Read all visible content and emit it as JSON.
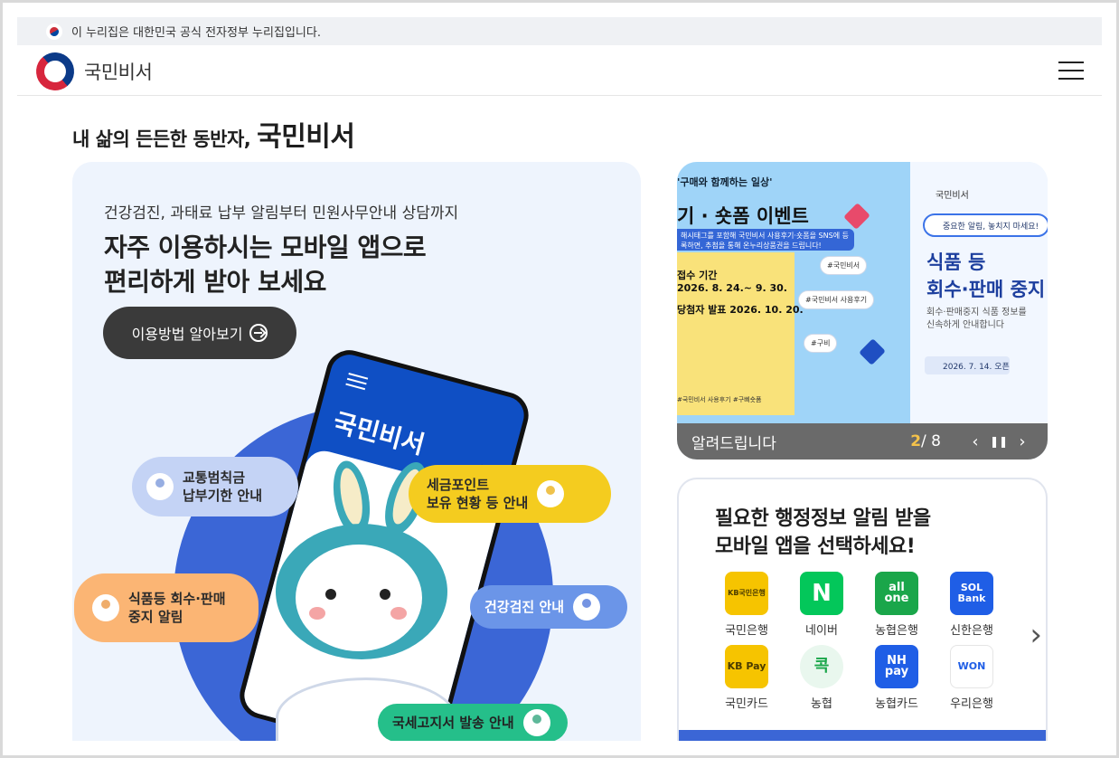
{
  "gov_bar": {
    "text": "이 누리집은 대한민국 공식 전자정부 누리집입니다."
  },
  "header": {
    "logo_text": "국민비서"
  },
  "tagline": {
    "prefix": "내 삶의 든든한 동반자,",
    "brand": "국민비서"
  },
  "hero": {
    "subtitle": "건강검진, 과태료 납부 알림부터 민원사무안내 상담까지",
    "title_line1": "자주 이용하시는 모바일 앱으로",
    "title_line2": "편리하게 받아 보세요",
    "button": "이용방법 알아보기",
    "phone_title": "국민비서",
    "bubbles": [
      {
        "line1": "교통범칙금",
        "line2": "납부기한 안내"
      },
      {
        "line1": "세금포인트",
        "line2": "보유 현황 등 안내"
      },
      {
        "line1": "식품등 회수·판매",
        "line2": "중지 알림"
      },
      {
        "line1": "건강검진 안내",
        "line2": ""
      },
      {
        "line1": "국세고지서 발송 안내",
        "line2": ""
      }
    ]
  },
  "carousel": {
    "slide_a": {
      "title_small": "'구매와 함께하는 일상'",
      "title_big": "기 · 숏폼 이벤트",
      "banner": "해시태그를 포함해 국민비서 사용후기·숏폼을 SNS에 등록하면, 추첨을 통해 온누리상품권을 드립니다!",
      "period_label": "접수 기간",
      "period": "2026. 8. 24.~ 9. 30.",
      "announce_label": "당첨자 발표",
      "announce": "2026. 10. 20.",
      "tags": [
        "#국민비서",
        "#국민비서 사용후기",
        "#구비"
      ],
      "hashtags_footer": "#국민비서 사용후기 #구삐숏폼"
    },
    "slide_b": {
      "brand": "국민비서",
      "notice": "중요한 알림, 놓치지 마세요!",
      "headline_1": "식품 등",
      "headline_2": "회수·판매 중지",
      "desc_1": "회수·판매중지 식품 정보를",
      "desc_2": "신속하게 안내합니다",
      "date": "2026. 7. 14. 오픈"
    },
    "label": "알려드립니다",
    "current": "2",
    "total": "/ 8",
    "prev_icon": "‹",
    "pause_icon": "❚❚",
    "next_icon": "›"
  },
  "apps": {
    "title_line1": "필요한 행정정보 알림 받을",
    "title_line2": "모바일 앱을 선택하세요!",
    "items": [
      {
        "name": "국민은행",
        "icon_text": "KB국민은행",
        "bg": "#f6c400",
        "fg": "#4a3b00"
      },
      {
        "name": "네이버",
        "icon_text": "N",
        "bg": "#03c75a",
        "fg": "#ffffff"
      },
      {
        "name": "농협은행",
        "icon_text": "all one",
        "bg": "#1aa64a",
        "fg": "#ffffff"
      },
      {
        "name": "신한은행",
        "icon_text": "SOL Bank",
        "bg": "#1f5ee6",
        "fg": "#ffffff"
      },
      {
        "name": "국민카드",
        "icon_text": "KB Pay",
        "bg": "#f6c400",
        "fg": "#4a3b00"
      },
      {
        "name": "농협",
        "icon_text": "콕",
        "bg": "#ffffff",
        "fg": "#1aa64a"
      },
      {
        "name": "농협카드",
        "icon_text": "NH pay",
        "bg": "#1f5ee6",
        "fg": "#ffffff"
      },
      {
        "name": "우리은행",
        "icon_text": "WON",
        "bg": "#ffffff",
        "fg": "#1f5ee6"
      }
    ],
    "next_icon": "›"
  }
}
